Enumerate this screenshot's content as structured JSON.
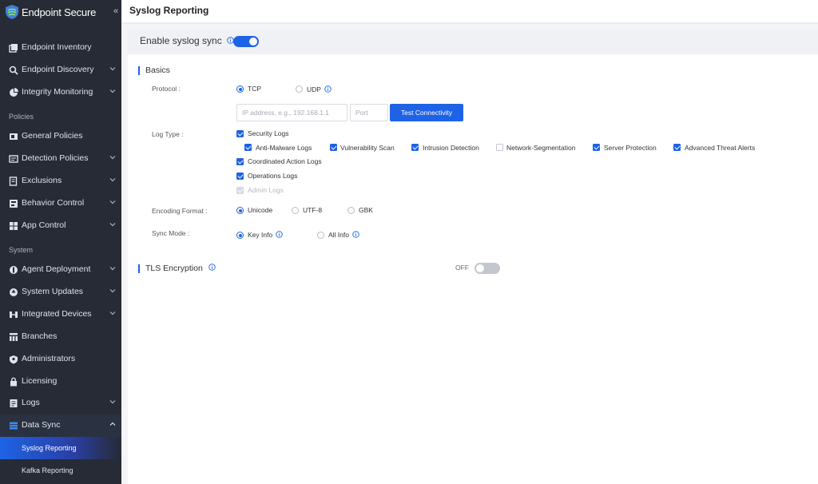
{
  "app": {
    "name": "Endpoint Secure"
  },
  "sidebar": {
    "top_items": [
      {
        "label": "Endpoint Inventory",
        "icon": "inventory-icon"
      },
      {
        "label": "Endpoint Discovery",
        "icon": "search-icon"
      },
      {
        "label": "Integrity Monitoring",
        "icon": "pie-chart-icon"
      }
    ],
    "policies_section": "Policies",
    "policy_items": [
      {
        "label": "General Policies",
        "icon": "policy-icon"
      },
      {
        "label": "Detection Policies",
        "icon": "detection-icon"
      },
      {
        "label": "Exclusions",
        "icon": "exclusion-icon"
      },
      {
        "label": "Behavior Control",
        "icon": "behavior-icon"
      },
      {
        "label": "App Control",
        "icon": "app-control-icon"
      }
    ],
    "system_section": "System",
    "system_items": [
      {
        "label": "Agent Deployment",
        "icon": "deployment-icon"
      },
      {
        "label": "System Updates",
        "icon": "update-icon"
      },
      {
        "label": "Integrated Devices",
        "icon": "devices-icon"
      },
      {
        "label": "Branches",
        "icon": "branches-icon"
      },
      {
        "label": "Administrators",
        "icon": "admin-icon"
      },
      {
        "label": "Licensing",
        "icon": "lock-icon"
      },
      {
        "label": "Logs",
        "icon": "logs-icon"
      },
      {
        "label": "Data Sync",
        "icon": "data-sync-icon"
      }
    ],
    "sub_items": [
      {
        "label": "Syslog Reporting",
        "selected": true
      },
      {
        "label": "Kafka Reporting",
        "selected": false
      }
    ]
  },
  "header": {
    "title": "Syslog Reporting"
  },
  "enable": {
    "label": "Enable syslog sync",
    "on": true
  },
  "basics": {
    "title": "Basics",
    "protocol_label": "Protocol :",
    "protocol_options": [
      "TCP",
      "UDP"
    ],
    "ip_placeholder": "IP address, e.g., 192.168.1.1",
    "port_placeholder": "Port",
    "test_button": "Test Connectivity",
    "log_type_label": "Log Type :",
    "security_logs": "Security Logs",
    "security_sub": [
      {
        "label": "Anti-Malware Logs",
        "checked": true
      },
      {
        "label": "Vulnerability Scan",
        "checked": true
      },
      {
        "label": "Intrusion Detection",
        "checked": true
      },
      {
        "label": "Network-Segmentation",
        "checked": false
      },
      {
        "label": "Server Protection",
        "checked": true
      },
      {
        "label": "Advanced Threat Alerts",
        "checked": true
      }
    ],
    "coordinated_logs": "Coordinated Action Logs",
    "operations_logs": "Operations Logs",
    "admin_logs": "Admin Logs",
    "encoding_label": "Encoding Format :",
    "encoding_options": [
      "Unicode",
      "UTF-8",
      "GBK"
    ],
    "sync_mode_label": "Sync Mode :",
    "sync_options": [
      "Key Info",
      "All Info"
    ]
  },
  "tls": {
    "title": "TLS Encryption",
    "state_label": "OFF"
  },
  "colors": {
    "accent": "#1e63e6",
    "sidebar_bg": "#262b35"
  }
}
